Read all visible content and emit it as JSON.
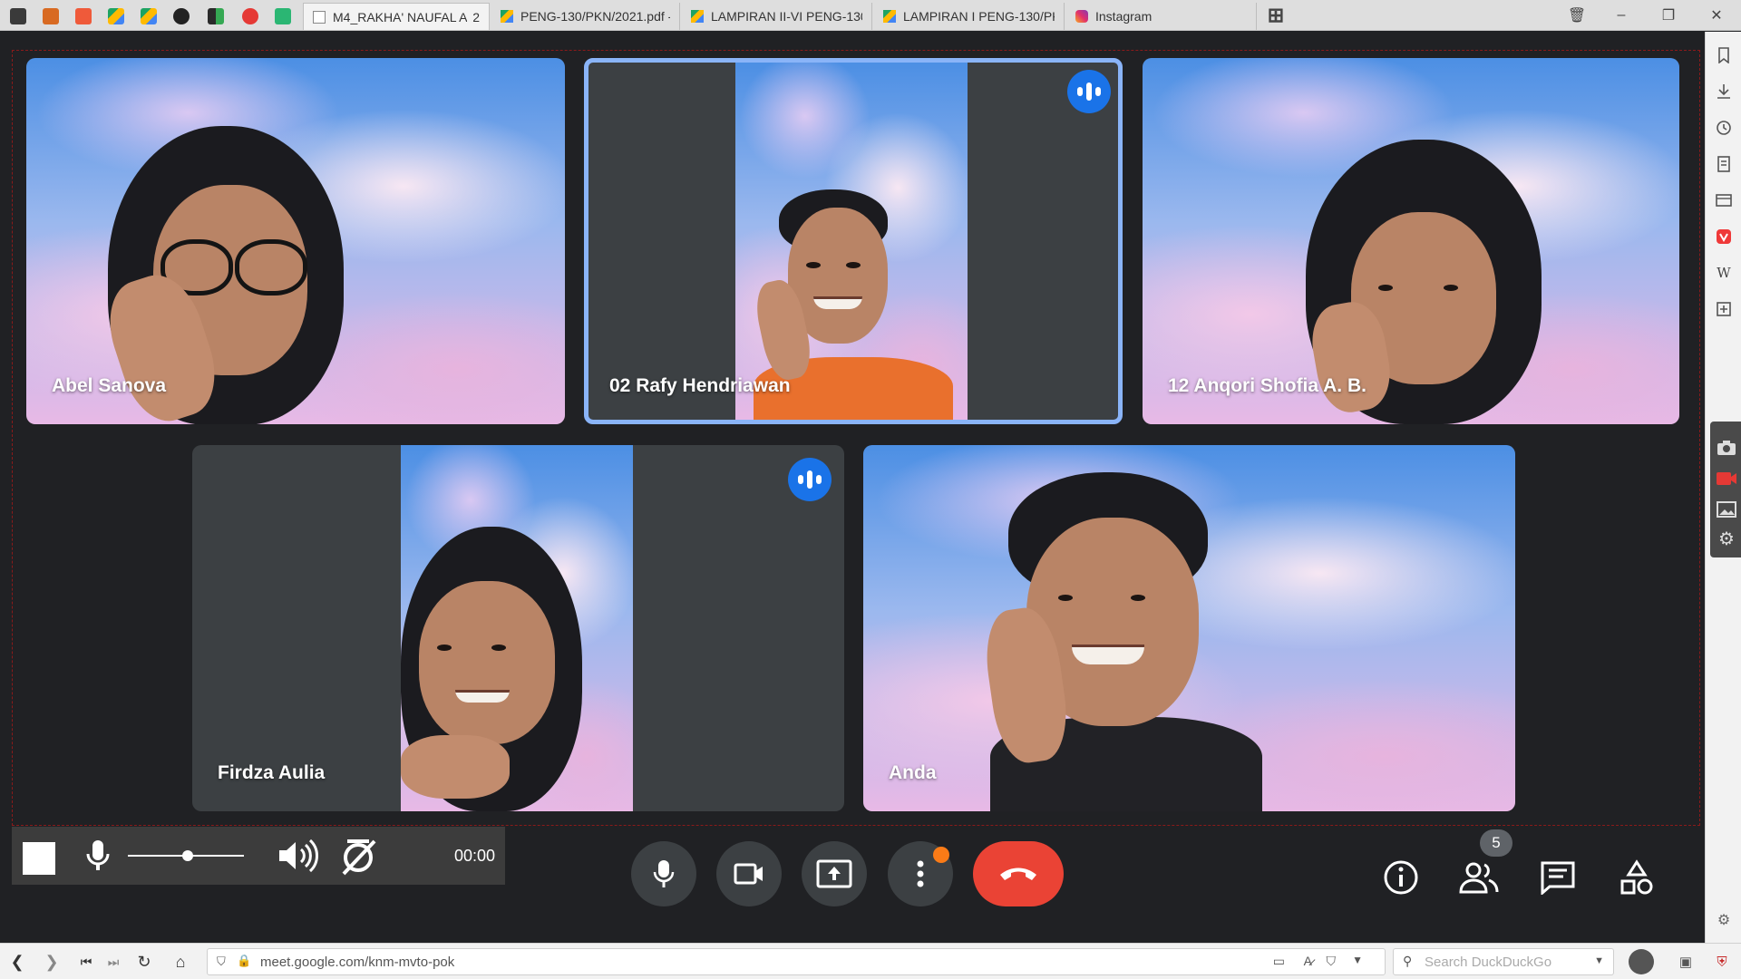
{
  "browser": {
    "pinned_tabs": [
      "vivaldi-icon",
      "ppt-icon",
      "shop-icon",
      "drive-icon",
      "drive-icon",
      "medium-icon",
      "app-icon",
      "app-icon",
      "app-icon"
    ],
    "tabs": [
      {
        "label": "M4_RAKHA' NAUFAL A",
        "count": "2",
        "active": true
      },
      {
        "label": "PENG-130/PKN/2021.pdf -",
        "active": false
      },
      {
        "label": "LAMPIRAN II-VI PENG-130/",
        "active": false
      },
      {
        "label": "LAMPIRAN I PENG-130/PKN",
        "active": false
      },
      {
        "label": "Instagram",
        "active": false
      }
    ],
    "url": "meet.google.com/knm-mvto-pok",
    "search_placeholder": "Search DuckDuckGo"
  },
  "meeting": {
    "participants": [
      {
        "name": "Abel Sanova",
        "speaking": false
      },
      {
        "name": "02 Rafy Hendriawan",
        "speaking": true
      },
      {
        "name": "12 Anqori Shofia A. B.",
        "speaking": false
      },
      {
        "name": "Firdza Aulia",
        "speaking": true
      },
      {
        "name": "Anda",
        "speaking": false
      }
    ],
    "participant_count": "5"
  },
  "recorder": {
    "timer": "00:00"
  },
  "colors": {
    "hangup": "#ea4335",
    "speaking_badge": "#1a73e8",
    "active_border": "#8ab4f8",
    "notification_dot": "#fa7b17"
  }
}
